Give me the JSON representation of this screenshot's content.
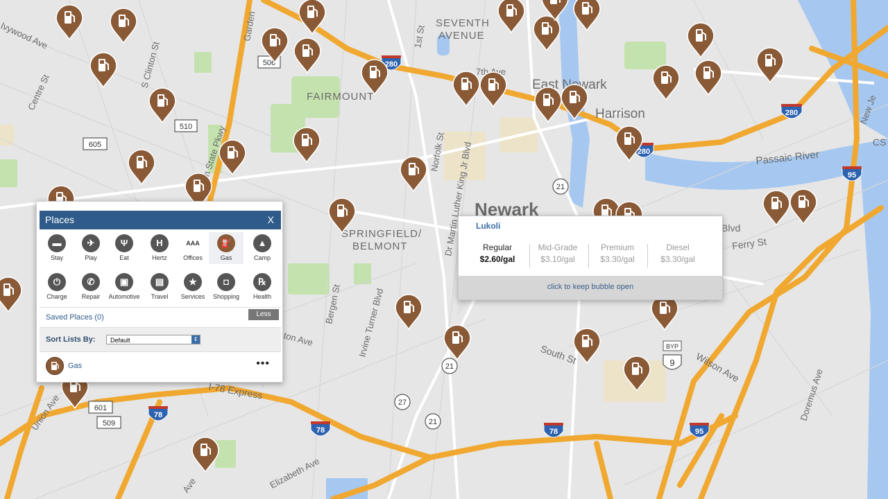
{
  "map": {
    "neighborhoods": [
      {
        "text": "SEVENTH"
      },
      {
        "text": "AVENUE"
      },
      {
        "text": "FAIRMOUNT"
      },
      {
        "text": "SPRINGFIELD/"
      },
      {
        "text": "BELMONT"
      }
    ],
    "cities": [
      {
        "text": "East Newark"
      },
      {
        "text": "Harrison"
      },
      {
        "text": "Newark"
      }
    ],
    "streets": [
      {
        "text": "Ivywood Ave"
      },
      {
        "text": "Centre St"
      },
      {
        "text": "S Clinton St"
      },
      {
        "text": "Garden"
      },
      {
        "text": "Garden State Pkwy"
      },
      {
        "text": "1st St"
      },
      {
        "text": "7th Ave"
      },
      {
        "text": "Norfolk St"
      },
      {
        "text": "Dr Martin Luther King Jr Blvd"
      },
      {
        "text": "Bergen St"
      },
      {
        "text": "Irvine Turner Blvd"
      },
      {
        "text": "ton Ave"
      },
      {
        "text": "South St"
      },
      {
        "text": "Wilson Ave"
      },
      {
        "text": "Doremus Ave"
      },
      {
        "text": "Ferry St"
      },
      {
        "text": "Blvd"
      },
      {
        "text": "I-78 Express"
      },
      {
        "text": "Union Ave"
      },
      {
        "text": "Elizabeth Ave"
      },
      {
        "text": "Ave"
      },
      {
        "text": "New Je"
      },
      {
        "text": "CS"
      }
    ],
    "water": [
      {
        "text": "Passaic River"
      }
    ],
    "shields": [
      {
        "text": "280"
      },
      {
        "text": "280"
      },
      {
        "text": "280"
      },
      {
        "text": "95"
      },
      {
        "text": "95"
      },
      {
        "text": "78"
      },
      {
        "text": "78"
      },
      {
        "text": "78"
      },
      {
        "text": "21"
      },
      {
        "text": "21"
      },
      {
        "text": "21"
      },
      {
        "text": "27"
      },
      {
        "text": "9"
      },
      {
        "text": "BYP"
      },
      {
        "text": "510"
      },
      {
        "text": "605"
      },
      {
        "text": "601"
      },
      {
        "text": "509"
      },
      {
        "text": "506"
      }
    ],
    "pin_icon": "gas-pump-icon",
    "pin_color": "#8a5a36"
  },
  "places_panel": {
    "title": "Places",
    "close_label": "X",
    "categories": [
      {
        "label": "Stay",
        "icon": "bed-icon",
        "glyph": "▬"
      },
      {
        "label": "Play",
        "icon": "ticket-icon",
        "glyph": "✈"
      },
      {
        "label": "Eat",
        "icon": "fork-icon",
        "glyph": "Ψ"
      },
      {
        "label": "Hertz",
        "icon": "hertz-icon",
        "glyph": "H"
      },
      {
        "label": "Offices",
        "icon": "aaa-icon",
        "glyph": "AAA"
      },
      {
        "label": "Gas",
        "icon": "gas-pump-icon",
        "glyph": "⛽"
      },
      {
        "label": "Camp",
        "icon": "tent-icon",
        "glyph": "▲"
      },
      {
        "label": "Charge",
        "icon": "plug-icon",
        "glyph": "⏻"
      },
      {
        "label": "Repair",
        "icon": "wrench-icon",
        "glyph": "✆"
      },
      {
        "label": "Automotive",
        "icon": "car-icon",
        "glyph": "▣"
      },
      {
        "label": "Travel",
        "icon": "suitcase-icon",
        "glyph": "▤"
      },
      {
        "label": "Services",
        "icon": "star-icon",
        "glyph": "★"
      },
      {
        "label": "Shopping",
        "icon": "shopping-bag-icon",
        "glyph": "◘"
      },
      {
        "label": "Health",
        "icon": "rx-icon",
        "glyph": "℞"
      }
    ],
    "selected_category": "Gas",
    "saved_places": "Saved Places (0)",
    "less_label": "Less",
    "sort_label": "Sort Lists By:",
    "sort_value": "Default",
    "list_item_label": "Gas",
    "more_label": "•••"
  },
  "bubble": {
    "title": "Lukoli",
    "prices": [
      {
        "grade": "Regular",
        "price": "$2.60/gal",
        "active": true
      },
      {
        "grade": "Mid-Grade",
        "price": "$3.10/gal",
        "active": false
      },
      {
        "grade": "Premium",
        "price": "$3.30/gal",
        "active": false
      },
      {
        "grade": "Diesel",
        "price": "$3.30/gal",
        "active": false
      }
    ],
    "footer": "click to keep bubble open"
  },
  "colors": {
    "highway": "#f0a830",
    "water": "#9fc3ee",
    "park": "#bfe0a5",
    "panel_header": "#2f5b8a"
  }
}
